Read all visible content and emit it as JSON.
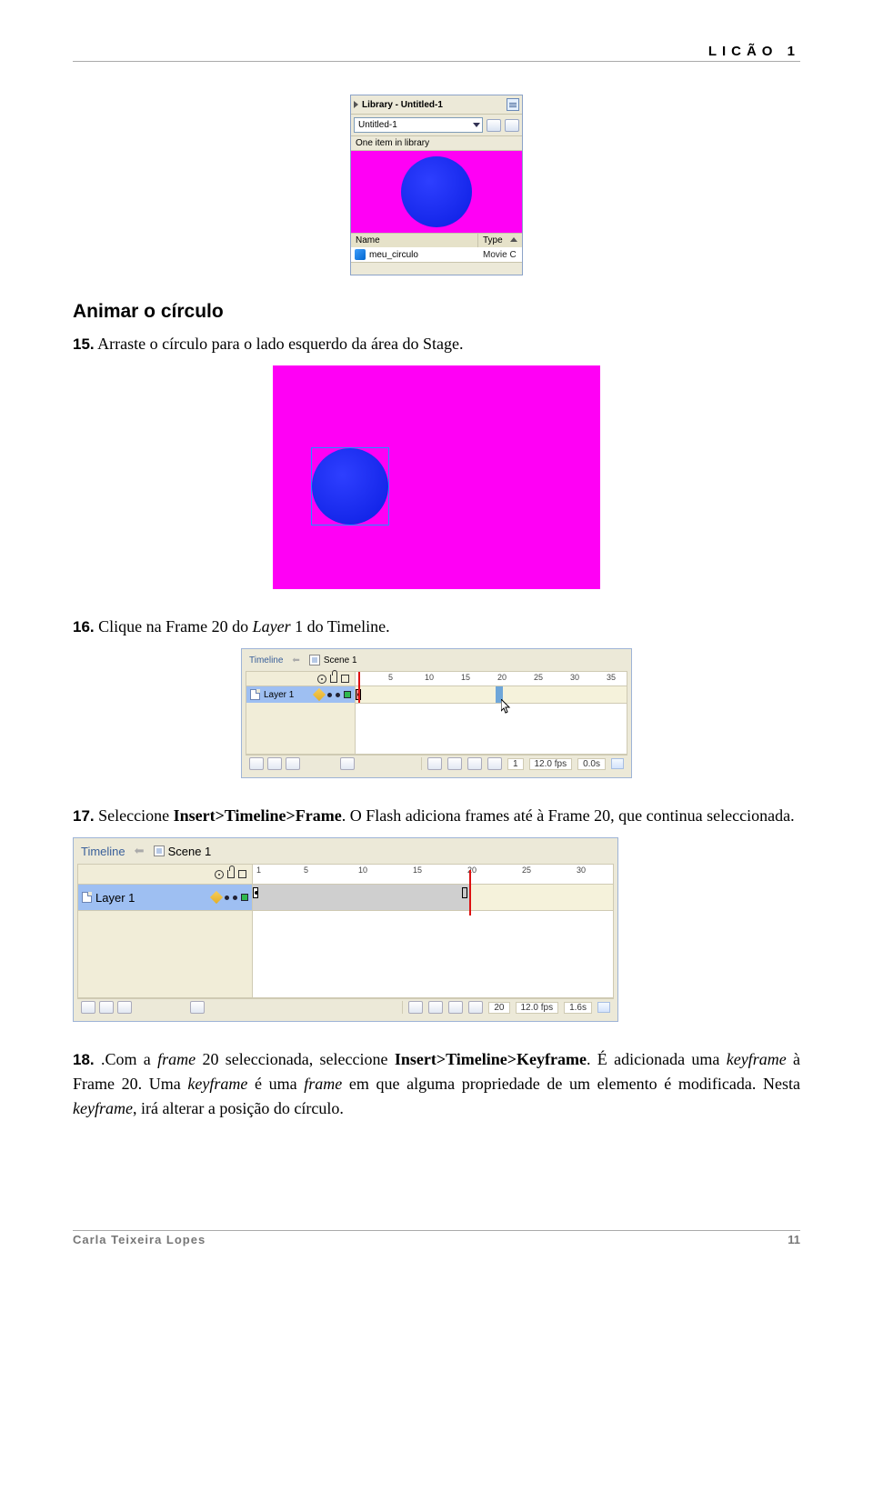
{
  "header": {
    "title": "LICÃO 1"
  },
  "library": {
    "panel_title": "Library - Untitled-1",
    "doc_name": "Untitled-1",
    "count_text": "One item in library",
    "col_name": "Name",
    "col_type": "Type",
    "item_name": "meu_circulo",
    "item_type": "Movie C"
  },
  "section": {
    "heading": "Animar o círculo"
  },
  "steps": {
    "s15": {
      "num": "15.",
      "text": "Arraste o círculo para o lado esquerdo da área do Stage."
    },
    "s16": {
      "num": "16.",
      "pre": "Clique na Frame 20 do ",
      "layer": "Layer",
      "mid": " 1 do Timeline."
    },
    "s17": {
      "num": "17.",
      "pre": "Seleccione ",
      "cmd": "Insert>Timeline>Frame",
      "post": ". O Flash adiciona frames até à Frame 20, que continua seleccionada."
    },
    "s18": {
      "num": "18.",
      "pre": ".Com a ",
      "f1": "frame",
      "t1": " 20 seleccionada, seleccione ",
      "cmd": "Insert>Timeline>Keyframe",
      "t2": ". É adicionada uma ",
      "f2": "keyframe",
      "t3": " à Frame 20. Uma ",
      "f3": "keyframe",
      "t4": " é uma ",
      "f4": "frame",
      "t5": " em que alguma propriedade de um elemento é modificada. Nesta ",
      "f5": "keyframe",
      "t6": ", irá alterar a posição do círculo."
    }
  },
  "timeline1": {
    "tab": "Timeline",
    "scene": "Scene 1",
    "layer": "Layer 1",
    "ticks": {
      "n5": "5",
      "n10": "10",
      "n15": "15",
      "n20": "20",
      "n25": "25",
      "n30": "30",
      "n35": "35"
    },
    "status": {
      "frame": "1",
      "fps": "12.0 fps",
      "time": "0.0s"
    }
  },
  "timeline2": {
    "tab": "Timeline",
    "scene": "Scene 1",
    "layer": "Layer 1",
    "ticks": {
      "n1": "1",
      "n5": "5",
      "n10": "10",
      "n15": "15",
      "n20": "20",
      "n25": "25",
      "n30": "30"
    },
    "status": {
      "frame": "20",
      "fps": "12.0 fps",
      "time": "1.6s"
    }
  },
  "footer": {
    "author": "Carla Teixeira Lopes",
    "page": "11"
  }
}
